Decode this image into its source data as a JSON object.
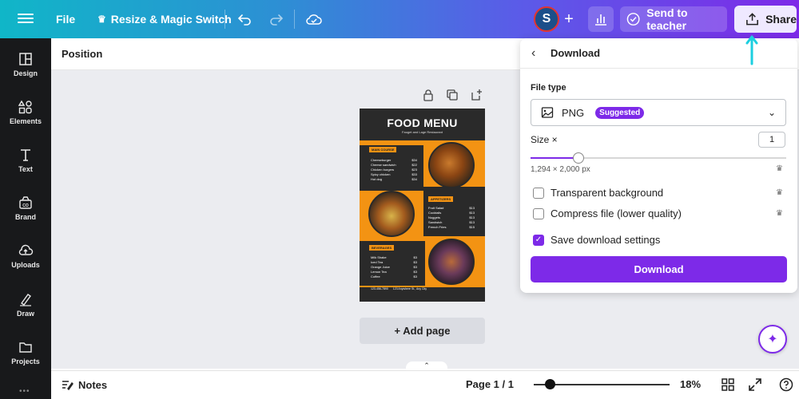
{
  "topbar": {
    "file_label": "File",
    "resize_label": "Resize & Magic Switch",
    "avatar_initial": "S",
    "send_label": "Send to teacher",
    "share_label": "Share"
  },
  "sidebar": {
    "items": [
      {
        "label": "Design",
        "icon": "design-icon"
      },
      {
        "label": "Elements",
        "icon": "elements-icon"
      },
      {
        "label": "Text",
        "icon": "text-icon"
      },
      {
        "label": "Brand",
        "icon": "brand-icon"
      },
      {
        "label": "Uploads",
        "icon": "uploads-icon"
      },
      {
        "label": "Draw",
        "icon": "draw-icon"
      },
      {
        "label": "Projects",
        "icon": "projects-icon"
      }
    ],
    "more": "•••"
  },
  "context": {
    "position_label": "Position"
  },
  "design": {
    "title": "FOOD MENU",
    "subtitle": "Fauget and Lage Restaurant",
    "sections": [
      {
        "tag": "MAIN COURSE",
        "items": [
          [
            "Cheeseburger",
            "$34"
          ],
          [
            "Cheese sandwich",
            "$22"
          ],
          [
            "Chicken burgers",
            "$23"
          ],
          [
            "Spicy chicken",
            "$33"
          ],
          [
            "Hot dog",
            "$34"
          ]
        ]
      },
      {
        "tag": "APPETIZERS",
        "items": [
          [
            "Fruit Salad",
            "$13"
          ],
          [
            "Cocktails",
            "$13"
          ],
          [
            "Nuggets",
            "$13"
          ],
          [
            "Sandwich",
            "$13"
          ],
          [
            "French Fries",
            "$15"
          ]
        ]
      },
      {
        "tag": "BEVERAGES",
        "items": [
          [
            "Milk Shake",
            "$3"
          ],
          [
            "Iced Tea",
            "$3"
          ],
          [
            "Orange Juice",
            "$3"
          ],
          [
            "Lemon Tea",
            "$3"
          ],
          [
            "Coffee",
            "$3"
          ]
        ]
      }
    ],
    "footer_phone": "123-456-7890",
    "footer_address": "123 Anywhere St., Any City"
  },
  "canvas": {
    "add_page_label": "+ Add page"
  },
  "footer": {
    "notes_label": "Notes",
    "page_label": "Page 1 / 1",
    "zoom_percent": 18,
    "zoom_label": "18%"
  },
  "download_panel": {
    "title": "Download",
    "file_type_label": "File type",
    "file_type_value": "PNG",
    "suggested_badge": "Suggested",
    "size_label": "Size ×",
    "size_value": "1",
    "dimensions": "1,294 × 2,000 px",
    "options": [
      {
        "label": "Transparent background",
        "checked": false,
        "pro": true
      },
      {
        "label": "Compress file (lower quality)",
        "checked": false,
        "pro": true
      },
      {
        "label": "Save download settings",
        "checked": true,
        "pro": false
      }
    ],
    "download_button": "Download"
  },
  "colors": {
    "accent": "#7d2ae8",
    "gradient_start": "#10b6c8",
    "menu_orange": "#f39313",
    "annotation": "#1ccfe0"
  }
}
